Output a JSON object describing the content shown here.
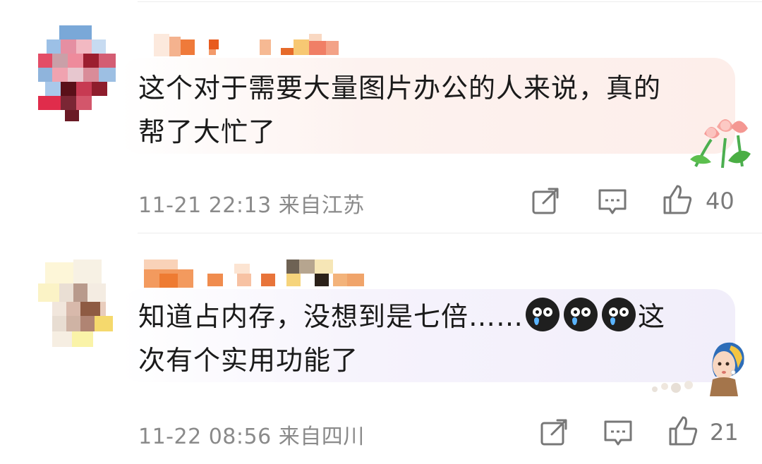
{
  "comments": [
    {
      "text": "这个对于需要大量图片办公的人来说，真的\n帮了大忙了",
      "meta": "11-21 22:13 来自江苏",
      "likes": "40",
      "icons": [
        "share-icon",
        "reply-icon",
        "like-icon"
      ]
    },
    {
      "text_main": "知道占内存，没想到是七倍……",
      "text_tail": "这\n次有个实用功能了",
      "emoji_icon": "crying-emoji-icon",
      "emoji_count": 3,
      "meta": "11-22 08:56 来自四川",
      "likes": "21",
      "icons": [
        "share-icon",
        "reply-icon",
        "like-icon"
      ]
    }
  ],
  "colors": {
    "bubble1": "#fdf1ee",
    "bubble2": "#f4f1fb",
    "meta_text": "#8a8a8a",
    "icon_stroke": "#777777",
    "divider": "#ececec"
  }
}
